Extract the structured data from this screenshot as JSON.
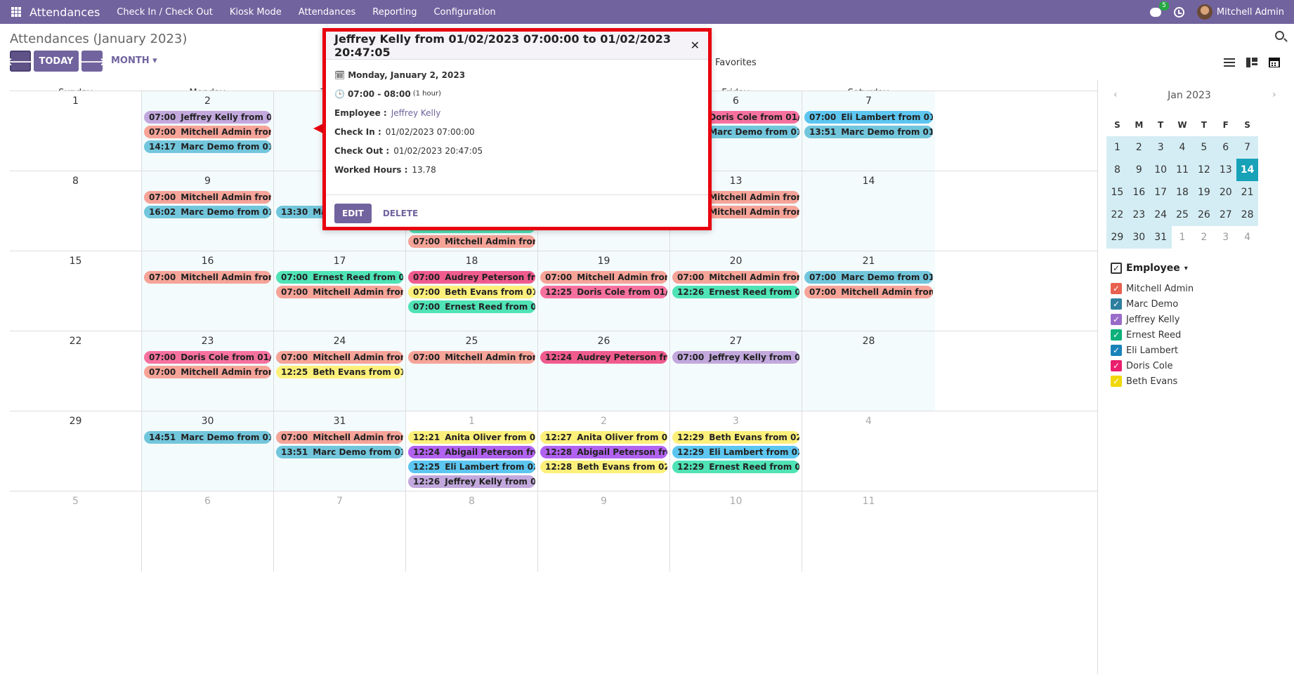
{
  "topbar": {
    "app_name": "Attendances",
    "menu": [
      "Check In / Check Out",
      "Kiosk Mode",
      "Attendances",
      "Reporting",
      "Configuration"
    ],
    "chat_badge": "5",
    "user_name": "Mitchell Admin"
  },
  "control_panel": {
    "breadcrumb": "Attendances (January 2023)",
    "today_label": "TODAY",
    "scale_label": "MONTH",
    "favorites_label": "Favorites"
  },
  "calendar": {
    "day_headers": [
      "Sunday",
      "Monday",
      "Tuesday",
      "Wednesday",
      "Thursday",
      "Friday",
      "Saturday"
    ],
    "weeks": [
      {
        "num": "1",
        "days": [
          {
            "d": "1",
            "cur": true,
            "events": []
          },
          {
            "d": "2",
            "cur": true,
            "events": [
              {
                "t": "07:00",
                "txt": "Jeffrey Kelly from 01/02/2023 07:00:00 to 01/02/2023 20:47:05",
                "c": "#c2a8dd"
              },
              {
                "t": "07:00",
                "txt": "Mitchell Admin from 01/02/2023 07:00:00",
                "c": "#f6a398"
              },
              {
                "t": "14:17",
                "txt": "Marc Demo from 01/02/2023 14:17:00",
                "c": "#72c6dc"
              }
            ]
          },
          {
            "d": "3",
            "cur": true,
            "events": []
          },
          {
            "d": "4",
            "cur": true,
            "events": []
          },
          {
            "d": "5",
            "cur": true,
            "events": [
              {
                "t": "",
                "txt": "rom 01/05/2023 07:00:00",
                "c": "#f7719f"
              },
              {
                "t": "",
                "txt": "from 01/05/2023 15:00:00",
                "c": "#72c6dc"
              }
            ]
          },
          {
            "d": "6",
            "cur": true,
            "events": [
              {
                "t": "07:00",
                "txt": "Doris Cole from 01/06/2023 07:00:00",
                "c": "#f7719f"
              },
              {
                "t": "15:40",
                "txt": "Marc Demo from 01/06/2023 15:40:00",
                "c": "#72c6dc"
              }
            ]
          },
          {
            "d": "7",
            "cur": true,
            "events": [
              {
                "t": "07:00",
                "txt": "Eli Lambert from 01/07/2023 07:00:00",
                "c": "#5cc6f0"
              },
              {
                "t": "13:51",
                "txt": "Marc Demo from 01/07/2023 13:51:00",
                "c": "#72c6dc"
              }
            ]
          }
        ]
      },
      {
        "num": "2",
        "days": [
          {
            "d": "8",
            "cur": true,
            "events": []
          },
          {
            "d": "9",
            "cur": true,
            "events": [
              {
                "t": "07:00",
                "txt": "Mitchell Admin from 01/09/2023 07:00:00",
                "c": "#f6a398"
              },
              {
                "t": "16:02",
                "txt": "Marc Demo from 01/09/2023 16:02:00",
                "c": "#72c6dc"
              }
            ]
          },
          {
            "d": "10",
            "cur": true,
            "events": [
              {
                "t": "",
                "txt": "",
                "c": "transparent"
              },
              {
                "t": "13:30",
                "txt": "Marc Demo from 01/10/2023 13:30:00",
                "c": "#72c6dc"
              }
            ]
          },
          {
            "d": "11",
            "cur": true,
            "events": [
              {
                "t": "",
                "txt": "",
                "c": "transparent"
              },
              {
                "t": "07:00",
                "txt": "Eli Lambert from 01/11/2023 07:00:00",
                "c": "#5cc6f0"
              },
              {
                "t": "07:00",
                "txt": "Ernest Reed from 01/11/2023 07:00:00",
                "c": "#4fe3b5"
              },
              {
                "t": "07:00",
                "txt": "Mitchell Admin from 01/11/2023 07:00:00",
                "c": "#f6a398"
              }
            ]
          },
          {
            "d": "12",
            "cur": true,
            "events": [
              {
                "t": "",
                "txt": "rom 01/12/2023 07:00:00",
                "c": "#f7719f"
              },
              {
                "t": "07:00",
                "txt": "Mitchell Admin from 01/12/2023 07:00:00",
                "c": "#f6a398"
              }
            ]
          },
          {
            "d": "13",
            "cur": true,
            "events": [
              {
                "t": "13:30",
                "txt": "Mitchell Admin from 01/13/2023 13:30:00",
                "c": "#f6a398"
              },
              {
                "t": "18:32",
                "txt": "Mitchell Admin from 01/13/2023 18:32:00",
                "c": "#f6a398"
              }
            ]
          },
          {
            "d": "14",
            "cur": true,
            "events": []
          }
        ]
      },
      {
        "num": "3",
        "days": [
          {
            "d": "15",
            "cur": true,
            "events": []
          },
          {
            "d": "16",
            "cur": true,
            "events": [
              {
                "t": "07:00",
                "txt": "Mitchell Admin from 01/16/2023 07:00:00",
                "c": "#f6a398"
              }
            ]
          },
          {
            "d": "17",
            "cur": true,
            "events": [
              {
                "t": "07:00",
                "txt": "Ernest Reed from 01/17/2023 07:00:00",
                "c": "#4fe3b5"
              },
              {
                "t": "07:00",
                "txt": "Mitchell Admin from 01/17/2023 07:00:00",
                "c": "#f6a398"
              }
            ]
          },
          {
            "d": "18",
            "cur": true,
            "events": [
              {
                "t": "07:00",
                "txt": "Audrey Peterson from 01/18/2023 07:00:00",
                "c": "#f05b8e"
              },
              {
                "t": "07:00",
                "txt": "Beth Evans from 01/18/2023 07:00:00",
                "c": "#fdf07a"
              },
              {
                "t": "07:00",
                "txt": "Ernest Reed from 01/18/2023 07:00:00",
                "c": "#4fe3b5"
              }
            ]
          },
          {
            "d": "19",
            "cur": true,
            "events": [
              {
                "t": "07:00",
                "txt": "Mitchell Admin from 01/19/2023 07:00:00",
                "c": "#f6a398"
              },
              {
                "t": "12:25",
                "txt": "Doris Cole from 01/19/2023 12:25:00",
                "c": "#f7719f"
              }
            ]
          },
          {
            "d": "20",
            "cur": true,
            "events": [
              {
                "t": "07:00",
                "txt": "Mitchell Admin from 01/20/2023 07:00:00",
                "c": "#f6a398"
              },
              {
                "t": "12:26",
                "txt": "Ernest Reed from 01/20/2023 12:26:00",
                "c": "#4fe3b5"
              }
            ]
          },
          {
            "d": "21",
            "cur": true,
            "events": [
              {
                "t": "07:00",
                "txt": "Marc Demo from 01/21/2023 07:00:00",
                "c": "#72c6dc"
              },
              {
                "t": "07:00",
                "txt": "Mitchell Admin from 01/21/2023 07:00:00",
                "c": "#f6a398"
              }
            ]
          }
        ]
      },
      {
        "num": "4",
        "days": [
          {
            "d": "22",
            "cur": true,
            "events": []
          },
          {
            "d": "23",
            "cur": true,
            "events": [
              {
                "t": "07:00",
                "txt": "Doris Cole from 01/23/2023 07:00:00",
                "c": "#f7719f"
              },
              {
                "t": "07:00",
                "txt": "Mitchell Admin from 01/23/2023 07:00:00",
                "c": "#f6a398"
              }
            ]
          },
          {
            "d": "24",
            "cur": true,
            "events": [
              {
                "t": "07:00",
                "txt": "Mitchell Admin from 01/24/2023 07:00:00",
                "c": "#f6a398"
              },
              {
                "t": "12:25",
                "txt": "Beth Evans from 01/24/2023 12:25:00",
                "c": "#fdf07a"
              }
            ]
          },
          {
            "d": "25",
            "cur": true,
            "events": [
              {
                "t": "07:00",
                "txt": "Mitchell Admin from 01/25/2023 07:00:00",
                "c": "#f6a398"
              }
            ]
          },
          {
            "d": "26",
            "cur": true,
            "events": [
              {
                "t": "12:24",
                "txt": "Audrey Peterson from 01/26/2023 12:24:00",
                "c": "#f05b8e"
              }
            ]
          },
          {
            "d": "27",
            "cur": true,
            "events": [
              {
                "t": "07:00",
                "txt": "Jeffrey Kelly from 01/27/2023 07:00:00",
                "c": "#c2a8dd"
              }
            ]
          },
          {
            "d": "28",
            "cur": true,
            "events": []
          }
        ]
      },
      {
        "num": "5",
        "days": [
          {
            "d": "29",
            "cur": true,
            "events": []
          },
          {
            "d": "30",
            "cur": true,
            "events": [
              {
                "t": "14:51",
                "txt": "Marc Demo from 01/30/2023 14:51:00",
                "c": "#72c6dc"
              }
            ]
          },
          {
            "d": "31",
            "cur": true,
            "events": [
              {
                "t": "07:00",
                "txt": "Mitchell Admin from 01/31/2023 07:00:00",
                "c": "#f6a398"
              },
              {
                "t": "13:51",
                "txt": "Marc Demo from 01/31/2023 13:51:00",
                "c": "#72c6dc"
              }
            ]
          },
          {
            "d": "1",
            "cur": false,
            "events": [
              {
                "t": "12:21",
                "txt": "Anita Oliver from 02/01/2023 12:21:00",
                "c": "#fdf07a"
              },
              {
                "t": "12:24",
                "txt": "Abigail Peterson from 02/01/2023 12:24:00",
                "c": "#b262f0"
              },
              {
                "t": "12:25",
                "txt": "Eli Lambert from 02/01/2023 12:25:00",
                "c": "#5cc6f0"
              },
              {
                "t": "12:26",
                "txt": "Jeffrey Kelly from 02/01/2023 12:26:00",
                "c": "#c2a8dd"
              }
            ]
          },
          {
            "d": "2",
            "cur": false,
            "events": [
              {
                "t": "12:27",
                "txt": "Anita Oliver from 02/02/2023 12:27:00",
                "c": "#fdf07a"
              },
              {
                "t": "12:28",
                "txt": "Abigail Peterson from 02/02/2023 12:28:00",
                "c": "#b262f0"
              },
              {
                "t": "12:28",
                "txt": "Beth Evans from 02/02/2023 12:28:00",
                "c": "#fdf07a"
              }
            ]
          },
          {
            "d": "3",
            "cur": false,
            "events": [
              {
                "t": "12:29",
                "txt": "Beth Evans from 02/03/2023 12:29:00",
                "c": "#fdf07a"
              },
              {
                "t": "12:29",
                "txt": "Eli Lambert from 02/03/2023 12:29:00",
                "c": "#5cc6f0"
              },
              {
                "t": "12:29",
                "txt": "Ernest Reed from 02/03/2023 12:29:00",
                "c": "#4fe3b5"
              }
            ]
          },
          {
            "d": "4",
            "cur": false,
            "events": []
          }
        ]
      },
      {
        "num": "6",
        "days": [
          {
            "d": "5",
            "cur": false,
            "events": []
          },
          {
            "d": "6",
            "cur": false,
            "events": []
          },
          {
            "d": "7",
            "cur": false,
            "events": []
          },
          {
            "d": "8",
            "cur": false,
            "events": []
          },
          {
            "d": "9",
            "cur": false,
            "events": []
          },
          {
            "d": "10",
            "cur": false,
            "events": []
          },
          {
            "d": "11",
            "cur": false,
            "events": []
          }
        ]
      }
    ]
  },
  "mini_calendar": {
    "title": "Jan 2023",
    "weekday_letters": [
      "S",
      "M",
      "T",
      "W",
      "T",
      "F",
      "S"
    ],
    "rows": [
      [
        "1",
        "2",
        "3",
        "4",
        "5",
        "6",
        "7"
      ],
      [
        "8",
        "9",
        "10",
        "11",
        "12",
        "13",
        "14"
      ],
      [
        "15",
        "16",
        "17",
        "18",
        "19",
        "20",
        "21"
      ],
      [
        "22",
        "23",
        "24",
        "25",
        "26",
        "27",
        "28"
      ],
      [
        "29",
        "30",
        "31",
        "1",
        "2",
        "3",
        "4"
      ]
    ],
    "selected": "14"
  },
  "filters": {
    "heading": "Employee",
    "items": [
      {
        "name": "Mitchell Admin",
        "color": "#e8604f"
      },
      {
        "name": "Marc Demo",
        "color": "#2e7f9f"
      },
      {
        "name": "Jeffrey Kelly",
        "color": "#9a6cc9"
      },
      {
        "name": "Ernest Reed",
        "color": "#0bb07a"
      },
      {
        "name": "Eli Lambert",
        "color": "#1a82b8"
      },
      {
        "name": "Doris Cole",
        "color": "#ea1f6e"
      },
      {
        "name": "Beth Evans",
        "color": "#f0d80a"
      },
      {
        "name": "Audrey Peterson",
        "color": "#d6145f"
      },
      {
        "name": "Anita Oliver",
        "color": "#f0c10a"
      },
      {
        "name": "Abigail Peterson",
        "color": "#7a20c9"
      }
    ]
  },
  "popover": {
    "title": "Jeffrey Kelly from 01/02/2023 07:00:00 to 01/02/2023 20:47:05",
    "date": "Monday, January 2, 2023",
    "time": "07:00 - 08:00",
    "duration": "(1 hour)",
    "employee_label": "Employee :",
    "employee": "Jeffrey Kelly",
    "check_in_label": "Check In :",
    "check_in": "01/02/2023 07:00:00",
    "check_out_label": "Check Out :",
    "check_out": "01/02/2023 20:47:05",
    "worked_label": "Worked Hours :",
    "worked": "13.78",
    "edit_label": "EDIT",
    "delete_label": "DELETE",
    "highlight_color": "#e8000f"
  }
}
